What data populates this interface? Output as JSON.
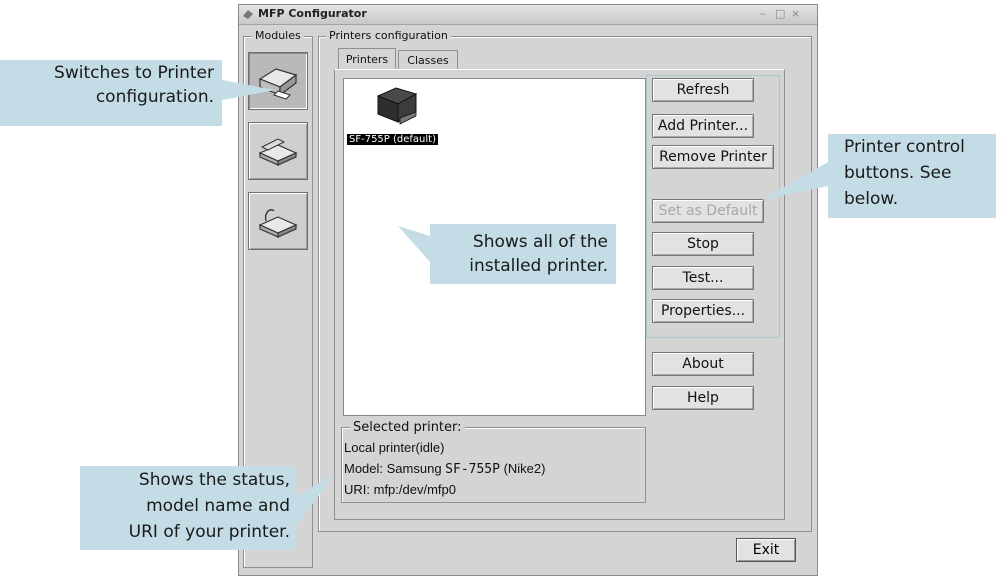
{
  "window": {
    "title": "MFP Configurator",
    "controls": [
      "–",
      "□",
      "×"
    ]
  },
  "modules": {
    "label": "Modules",
    "items": [
      {
        "name": "printer-module",
        "icon": "printer-icon",
        "active": true
      },
      {
        "name": "scanner-module",
        "icon": "scanner-icon",
        "active": false
      },
      {
        "name": "port-module",
        "icon": "port-icon",
        "active": false
      }
    ]
  },
  "printers_config": {
    "label": "Printers configuration",
    "tabs": [
      "Printers",
      "Classes"
    ],
    "printer_name": "SF-755P (default)"
  },
  "buttons": {
    "refresh": "Refresh",
    "add_printer": "Add Printer...",
    "remove_printer": "Remove Printer",
    "set_default": "Set as Default",
    "stop": "Stop",
    "test": "Test...",
    "properties": "Properties...",
    "about": "About",
    "help": "Help",
    "exit": "Exit"
  },
  "selected": {
    "label": "Selected printer:",
    "status": "Local printer(idle)",
    "model_prefix": "Model: Samsung ",
    "model_code": "SF-755P",
    "model_suffix": " (Nike2)",
    "uri": "URI: mfp:/dev/mfp0"
  },
  "callouts": {
    "switch": [
      "Switches to Printer",
      "configuration."
    ],
    "list": [
      "Shows all of the",
      "installed printer."
    ],
    "control": [
      "Printer control",
      "buttons. See",
      "below."
    ],
    "status": [
      "Shows the status,",
      "model name and",
      "URI of your printer."
    ]
  },
  "colors": {
    "callout_bg": "#c3dce6",
    "window_bg": "#d4d4d4"
  }
}
